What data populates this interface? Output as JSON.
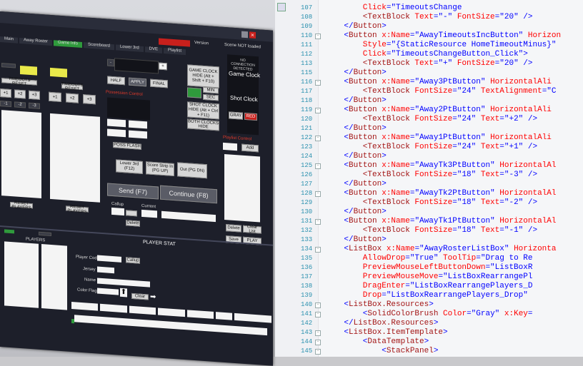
{
  "app": {
    "version_label": "Version",
    "scene_status": "Scene NOT loaded",
    "connection_status": "NO CONNECTION DETECTED",
    "top_red_button": "",
    "tabs": [
      "Main",
      "Away Roster",
      "Game Info",
      "Scoreboard",
      "Lower 3rd",
      "DVE",
      "Playlist"
    ],
    "game_clock_hide": "GAME CLOCK HIDE (Alt + Shift + F10)",
    "game_clock_title": "Game Clock",
    "shot_clock_title": "Shot Clock",
    "shot_clock_hide": "SHOT CLOCK HIDE (Alt + Ctrl + F11)",
    "both_clocks_hide": "BOTH CLOCKS HIDE",
    "half_button": "HALF",
    "apply_button": "APPLY",
    "final_button": "FINAL",
    "plus_symbol": "+",
    "minus_symbol": "-",
    "gray_button": "GRAY",
    "red_button": "RED",
    "min_label": "MIN",
    "sec_label": "SEC",
    "possession_label": "Possession Control",
    "poss_flash_button": "POSS FLASH",
    "lower3rd_button": "Lower 3rd (F12)",
    "score_strip_button": "Score Strip In (PG UP)",
    "out_button": "Out (PG DN)",
    "send_button": "Send (F7)",
    "continue_button": "Continue (F8)",
    "callup_label": "Callup",
    "current_label": "Current",
    "delete_small_button": "Delete",
    "playlist_control_label": "Playlist Control",
    "add_button": "Add",
    "delete_button": "Delete",
    "clear_list_button": "Clear List",
    "save_button": "Save",
    "play_button": "PLAY",
    "away_buttons": [
      "+1",
      "+2",
      "+3"
    ],
    "away_neg_buttons": [
      "-1",
      "-2",
      "-3"
    ],
    "home_buttons": [
      "+1",
      "+2",
      "+3"
    ],
    "timeouts_reset": "TIMEOUTS RESET",
    "reset_players": "RESET PLAYERS",
    "player_stat_title": "PLAYER STAT",
    "player_code_label": "Player Code",
    "jersey_label": "Jersey",
    "name_label": "Name",
    "color_flags_label": "Color Flags",
    "players_label": "PLAYERS",
    "callup_button": "Callup",
    "clear_button": "Clear",
    "bottom_green": ""
  },
  "editor": {
    "lines": [
      {
        "n": "107",
        "parts": [
          [
            "attr",
            "        Click"
          ],
          [
            "brk",
            "="
          ],
          [
            "val",
            "\"TimeoutsChange"
          ],
          [
            "attr",
            ""
          ]
        ]
      },
      {
        "n": "108",
        "parts": [
          [
            "tag",
            "        <TextBlock "
          ],
          [
            "attr",
            "Text"
          ],
          [
            "brk",
            "="
          ],
          [
            "val",
            "\"-\" "
          ],
          [
            "attr",
            "FontSize"
          ],
          [
            "brk",
            "="
          ],
          [
            "val",
            "\"20\" />"
          ]
        ]
      },
      {
        "n": "109",
        "parts": [
          [
            "brk",
            "    </"
          ],
          [
            "tag",
            "Button"
          ],
          [
            "brk",
            ">"
          ]
        ]
      },
      {
        "n": "110",
        "parts": [
          [
            "brk",
            "    <"
          ],
          [
            "tag",
            "Button "
          ],
          [
            "attr",
            "x:Name"
          ],
          [
            "brk",
            "="
          ],
          [
            "val",
            "\"AwayTimeoutsIncButton\" "
          ],
          [
            "attr",
            "Horizon"
          ]
        ]
      },
      {
        "n": "111",
        "parts": [
          [
            "attr",
            "        Style"
          ],
          [
            "brk",
            "="
          ],
          [
            "val",
            "\"{StaticResource HomeTimeoutMinus}\""
          ]
        ]
      },
      {
        "n": "112",
        "parts": [
          [
            "attr",
            "        Click"
          ],
          [
            "brk",
            "="
          ],
          [
            "val",
            "\"TimeoutsChangeButton_Click\">"
          ]
        ]
      },
      {
        "n": "113",
        "parts": [
          [
            "tag",
            "        <TextBlock "
          ],
          [
            "attr",
            "Text"
          ],
          [
            "brk",
            "="
          ],
          [
            "val",
            "\"+\" "
          ],
          [
            "attr",
            "FontSize"
          ],
          [
            "brk",
            "="
          ],
          [
            "val",
            "\"20\" />"
          ]
        ]
      },
      {
        "n": "115",
        "parts": [
          [
            "brk",
            "    </"
          ],
          [
            "tag",
            "Button"
          ],
          [
            "brk",
            ">"
          ]
        ]
      },
      {
        "n": "116",
        "parts": [
          [
            "brk",
            "    <"
          ],
          [
            "tag",
            "Button "
          ],
          [
            "attr",
            "x:Name"
          ],
          [
            "brk",
            "="
          ],
          [
            "val",
            "\"Away3PtButton\" "
          ],
          [
            "attr",
            "HorizontalAli"
          ]
        ]
      },
      {
        "n": "117",
        "parts": [
          [
            "tag",
            "        <TextBlock "
          ],
          [
            "attr",
            "FontSize"
          ],
          [
            "brk",
            "="
          ],
          [
            "val",
            "\"24\" "
          ],
          [
            "attr",
            "TextAlignment"
          ],
          [
            "brk",
            "="
          ],
          [
            "val",
            "\"C"
          ]
        ]
      },
      {
        "n": "118",
        "parts": [
          [
            "brk",
            "    </"
          ],
          [
            "tag",
            "Button"
          ],
          [
            "brk",
            ">"
          ]
        ]
      },
      {
        "n": "119",
        "parts": [
          [
            "brk",
            "    <"
          ],
          [
            "tag",
            "Button "
          ],
          [
            "attr",
            "x:Name"
          ],
          [
            "brk",
            "="
          ],
          [
            "val",
            "\"Away2PtButton\" "
          ],
          [
            "attr",
            "HorizontalAli"
          ]
        ]
      },
      {
        "n": "120",
        "parts": [
          [
            "tag",
            "        <TextBlock "
          ],
          [
            "attr",
            "FontSize"
          ],
          [
            "brk",
            "="
          ],
          [
            "val",
            "\"24\" "
          ],
          [
            "attr",
            "Text"
          ],
          [
            "brk",
            "="
          ],
          [
            "val",
            "\"+2\" />"
          ]
        ]
      },
      {
        "n": "121",
        "parts": [
          [
            "brk",
            "    </"
          ],
          [
            "tag",
            "Button"
          ],
          [
            "brk",
            ">"
          ]
        ]
      },
      {
        "n": "122",
        "parts": [
          [
            "brk",
            "    <"
          ],
          [
            "tag",
            "Button "
          ],
          [
            "attr",
            "x:Name"
          ],
          [
            "brk",
            "="
          ],
          [
            "val",
            "\"Away1PtButton\" "
          ],
          [
            "attr",
            "HorizontalAli"
          ]
        ]
      },
      {
        "n": "123",
        "parts": [
          [
            "tag",
            "        <TextBlock "
          ],
          [
            "attr",
            "FontSize"
          ],
          [
            "brk",
            "="
          ],
          [
            "val",
            "\"24\" "
          ],
          [
            "attr",
            "Text"
          ],
          [
            "brk",
            "="
          ],
          [
            "val",
            "\"+1\" />"
          ]
        ]
      },
      {
        "n": "124",
        "parts": [
          [
            "brk",
            "    </"
          ],
          [
            "tag",
            "Button"
          ],
          [
            "brk",
            ">"
          ]
        ]
      },
      {
        "n": "125",
        "parts": [
          [
            "brk",
            "    <"
          ],
          [
            "tag",
            "Button "
          ],
          [
            "attr",
            "x:Name"
          ],
          [
            "brk",
            "="
          ],
          [
            "val",
            "\"AwayTk3PtButton\" "
          ],
          [
            "attr",
            "HorizontalAl"
          ]
        ]
      },
      {
        "n": "126",
        "parts": [
          [
            "tag",
            "        <TextBlock "
          ],
          [
            "attr",
            "FontSize"
          ],
          [
            "brk",
            "="
          ],
          [
            "val",
            "\"18\" "
          ],
          [
            "attr",
            "Text"
          ],
          [
            "brk",
            "="
          ],
          [
            "val",
            "\"-3\" />"
          ]
        ]
      },
      {
        "n": "127",
        "parts": [
          [
            "brk",
            "    </"
          ],
          [
            "tag",
            "Button"
          ],
          [
            "brk",
            ">"
          ]
        ]
      },
      {
        "n": "128",
        "parts": [
          [
            "brk",
            "    <"
          ],
          [
            "tag",
            "Button "
          ],
          [
            "attr",
            "x:Name"
          ],
          [
            "brk",
            "="
          ],
          [
            "val",
            "\"AwayTk2PtButton\" "
          ],
          [
            "attr",
            "HorizontalAl"
          ]
        ]
      },
      {
        "n": "129",
        "parts": [
          [
            "tag",
            "        <TextBlock "
          ],
          [
            "attr",
            "FontSize"
          ],
          [
            "brk",
            "="
          ],
          [
            "val",
            "\"18\" "
          ],
          [
            "attr",
            "Text"
          ],
          [
            "brk",
            "="
          ],
          [
            "val",
            "\"-2\" />"
          ]
        ]
      },
      {
        "n": "130",
        "parts": [
          [
            "brk",
            "    </"
          ],
          [
            "tag",
            "Button"
          ],
          [
            "brk",
            ">"
          ]
        ]
      },
      {
        "n": "131",
        "parts": [
          [
            "brk",
            "    <"
          ],
          [
            "tag",
            "Button "
          ],
          [
            "attr",
            "x:Name"
          ],
          [
            "brk",
            "="
          ],
          [
            "val",
            "\"AwayTk1PtButton\" "
          ],
          [
            "attr",
            "HorizontalAl"
          ]
        ]
      },
      {
        "n": "132",
        "parts": [
          [
            "tag",
            "        <TextBlock "
          ],
          [
            "attr",
            "FontSize"
          ],
          [
            "brk",
            "="
          ],
          [
            "val",
            "\"18\" "
          ],
          [
            "attr",
            "Text"
          ],
          [
            "brk",
            "="
          ],
          [
            "val",
            "\"-1\" />"
          ]
        ]
      },
      {
        "n": "133",
        "parts": [
          [
            "brk",
            "    </"
          ],
          [
            "tag",
            "Button"
          ],
          [
            "brk",
            ">"
          ]
        ]
      },
      {
        "n": "134",
        "parts": [
          [
            "brk",
            "    <"
          ],
          [
            "tag",
            "ListBox "
          ],
          [
            "attr",
            "x:Name"
          ],
          [
            "brk",
            "="
          ],
          [
            "val",
            "\"AwayRosterListBox\" "
          ],
          [
            "attr",
            "Horizonta"
          ]
        ]
      },
      {
        "n": "135",
        "parts": [
          [
            "attr",
            "        AllowDrop"
          ],
          [
            "brk",
            "="
          ],
          [
            "val",
            "\"True\" "
          ],
          [
            "attr",
            "ToolTip"
          ],
          [
            "brk",
            "="
          ],
          [
            "val",
            "\"Drag to Re"
          ]
        ]
      },
      {
        "n": "136",
        "parts": [
          [
            "attr",
            "        PreviewMouseLeftButtonDown"
          ],
          [
            "brk",
            "="
          ],
          [
            "val",
            "\"ListBoxR"
          ]
        ]
      },
      {
        "n": "137",
        "parts": [
          [
            "attr",
            "        PreviewMouseMove"
          ],
          [
            "brk",
            "="
          ],
          [
            "val",
            "\"ListBoxRearrangePl"
          ]
        ]
      },
      {
        "n": "138",
        "parts": [
          [
            "attr",
            "        DragEnter"
          ],
          [
            "brk",
            "="
          ],
          [
            "val",
            "\"ListBoxRearrangePlayers_D"
          ]
        ]
      },
      {
        "n": "139",
        "parts": [
          [
            "attr",
            "        Drop"
          ],
          [
            "brk",
            "="
          ],
          [
            "val",
            "\"ListBoxRearrangePlayers_Drop\""
          ]
        ]
      },
      {
        "n": "140",
        "parts": [
          [
            "brk",
            "    <"
          ],
          [
            "tag",
            "ListBox.Resources"
          ],
          [
            "brk",
            ">"
          ]
        ]
      },
      {
        "n": "141",
        "parts": [
          [
            "brk",
            "        <"
          ],
          [
            "tag",
            "SolidColorBrush "
          ],
          [
            "attr",
            "Color"
          ],
          [
            "brk",
            "="
          ],
          [
            "val",
            "\"Gray\" "
          ],
          [
            "attr",
            "x:Key"
          ],
          [
            "brk",
            "="
          ]
        ]
      },
      {
        "n": "142",
        "parts": [
          [
            "brk",
            "    </"
          ],
          [
            "tag",
            "ListBox.Resources"
          ],
          [
            "brk",
            ">"
          ]
        ]
      },
      {
        "n": "143",
        "parts": [
          [
            "brk",
            "    <"
          ],
          [
            "tag",
            "ListBox.ItemTemplate"
          ],
          [
            "brk",
            ">"
          ]
        ]
      },
      {
        "n": "144",
        "parts": [
          [
            "brk",
            "        <"
          ],
          [
            "tag",
            "DataTemplate"
          ],
          [
            "brk",
            ">"
          ]
        ]
      },
      {
        "n": "145",
        "parts": [
          [
            "brk",
            "            <"
          ],
          [
            "tag",
            "StackPanel"
          ],
          [
            "brk",
            ">"
          ]
        ]
      }
    ]
  }
}
